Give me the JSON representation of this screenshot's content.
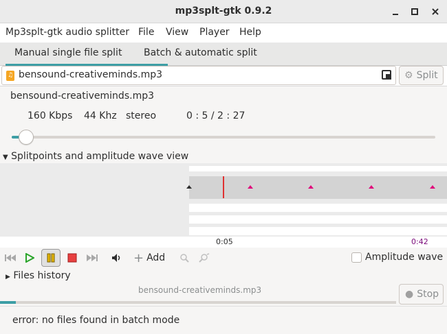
{
  "window": {
    "title": "mp3splt-gtk 0.9.2",
    "controls": [
      "minimize",
      "maximize",
      "close"
    ]
  },
  "menu": {
    "items": [
      "Mp3splt-gtk audio splitter",
      "File",
      "View",
      "Player",
      "Help"
    ]
  },
  "tabs": [
    {
      "label": "Manual single file split",
      "active": true
    },
    {
      "label": "Batch & automatic split",
      "active": false
    }
  ],
  "file_entry": {
    "value": "bensound-creativeminds.mp3",
    "split_label": "Split"
  },
  "track_info": {
    "filename": "bensound-creativeminds.mp3",
    "bitrate": "160 Kbps",
    "frequency": "44 Khz",
    "mode": "stereo",
    "time": "0 : 5 / 2 : 27",
    "progress_fraction": 0.034
  },
  "wave_section": {
    "label": "Splitpoints and amplitude wave view",
    "time_start": "0:05",
    "time_end": "0:42"
  },
  "player_controls": {
    "add_label": "Add",
    "amplitude_label": "Amplitude wave",
    "amplitude_checked": false
  },
  "files_history": {
    "label": "Files history"
  },
  "batch": {
    "current_file": "bensound-creativeminds.mp3",
    "stop_label": "Stop",
    "progress_fraction": 0.04
  },
  "status": {
    "message": "error: no files found in batch mode"
  },
  "colors": {
    "accent": "#3d9ea5",
    "marker": "#e0007a",
    "cursor": "#e03030",
    "end_time": "#7a0a7a"
  },
  "icons": {
    "file": "audio-file-icon",
    "browse": "browse-icon",
    "split": "gear-icon"
  }
}
